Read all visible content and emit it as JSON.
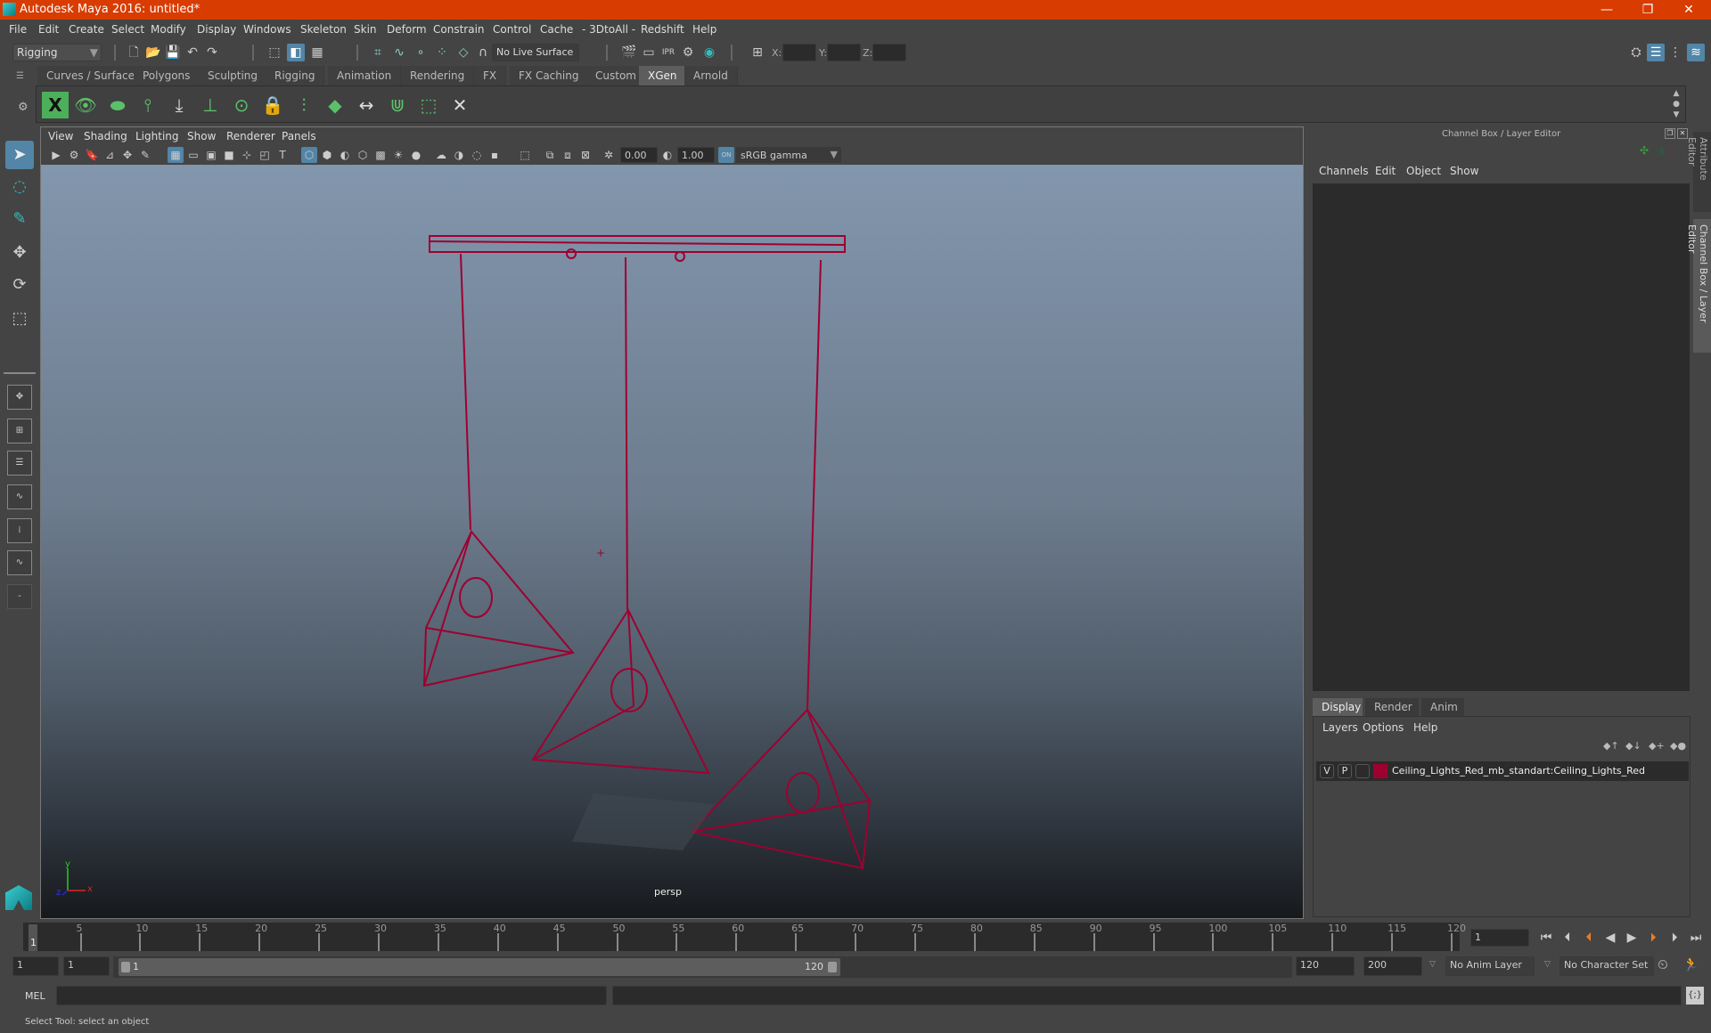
{
  "window": {
    "title": "Autodesk Maya 2016: untitled*",
    "controls": [
      "minimize-icon",
      "restore-icon",
      "close-icon"
    ]
  },
  "menubar": [
    "File",
    "Edit",
    "Create",
    "Select",
    "Modify",
    "Display",
    "Windows",
    "Skeleton",
    "Skin",
    "Deform",
    "Constrain",
    "Control",
    "Cache",
    "- 3DtoAll -",
    "Redshift",
    "Help"
  ],
  "statusline": {
    "menuset": "Rigging",
    "live_surface": "No Live Surface",
    "x_label": "X:",
    "y_label": "Y:",
    "z_label": "Z:",
    "x_value": "",
    "y_value": "",
    "z_value": ""
  },
  "shelf": {
    "tabs": [
      "Curves / Surfaces",
      "Polygons",
      "Sculpting",
      "Rigging",
      "Animation",
      "Rendering",
      "FX",
      "FX Caching",
      "Custom",
      "XGen",
      "Arnold"
    ],
    "active_tab": "XGen",
    "icons": [
      "xgen-window-icon",
      "xgen-preview-icon",
      "xgen-clear-preview-icon",
      "add-guides-icon",
      "move-guides-icon",
      "add-guide-icon",
      "select-guides-icon",
      "lock-guides-icon",
      "guides-flip-icon",
      "paint-map-icon",
      "guide-length-icon",
      "guide-bend-icon",
      "guide-select-icon",
      "delete-guide-icon"
    ]
  },
  "viewport": {
    "menus": [
      "View",
      "Shading",
      "Lighting",
      "Show",
      "Renderer",
      "Panels"
    ],
    "exposure": "0.00",
    "gamma": "1.00",
    "color_space": "sRGB gamma",
    "color_mgmt_label": "ON",
    "camera_label": "persp",
    "axis_labels": {
      "x": "x",
      "y": "y",
      "z": "z"
    },
    "wire_color": "#9e0030"
  },
  "right_panel": {
    "title": "Channel Box / Layer Editor",
    "vertical_tabs": [
      "Attribute Editor",
      "Channel Box / Layer Editor"
    ],
    "channel_menus": [
      "Channels",
      "Edit",
      "Object",
      "Show"
    ],
    "layer_tabs": [
      "Display",
      "Render",
      "Anim"
    ],
    "active_layer_tab": "Display",
    "layer_menus": [
      "Layers",
      "Options",
      "Help"
    ],
    "layers": [
      {
        "v": "V",
        "p": "P",
        "color": "#9e0030",
        "name": "Ceiling_Lights_Red_mb_standart:Ceiling_Lights_Red"
      }
    ]
  },
  "timeline": {
    "ticks": [
      1,
      5,
      10,
      15,
      20,
      25,
      30,
      35,
      40,
      45,
      50,
      55,
      60,
      65,
      70,
      75,
      80,
      85,
      90,
      95,
      100,
      105,
      110,
      115,
      120
    ],
    "range_min": 1,
    "range_max": 120,
    "current_frame_marker": "1",
    "current_frame": "1",
    "playback_buttons": [
      "go-to-start-icon",
      "step-back-key-icon",
      "step-back-frame-icon",
      "play-backward-icon",
      "play-forward-icon",
      "step-forward-frame-icon",
      "step-forward-key-icon",
      "go-to-end-icon"
    ]
  },
  "range": {
    "start": "1",
    "playback_start": "1",
    "slider_start": "1",
    "slider_end": "120",
    "playback_end": "120",
    "end": "200",
    "anim_layer": "No Anim Layer",
    "character_set": "No Character Set"
  },
  "command_line": {
    "label": "MEL",
    "value": ""
  },
  "help_line": "Select Tool: select an object"
}
